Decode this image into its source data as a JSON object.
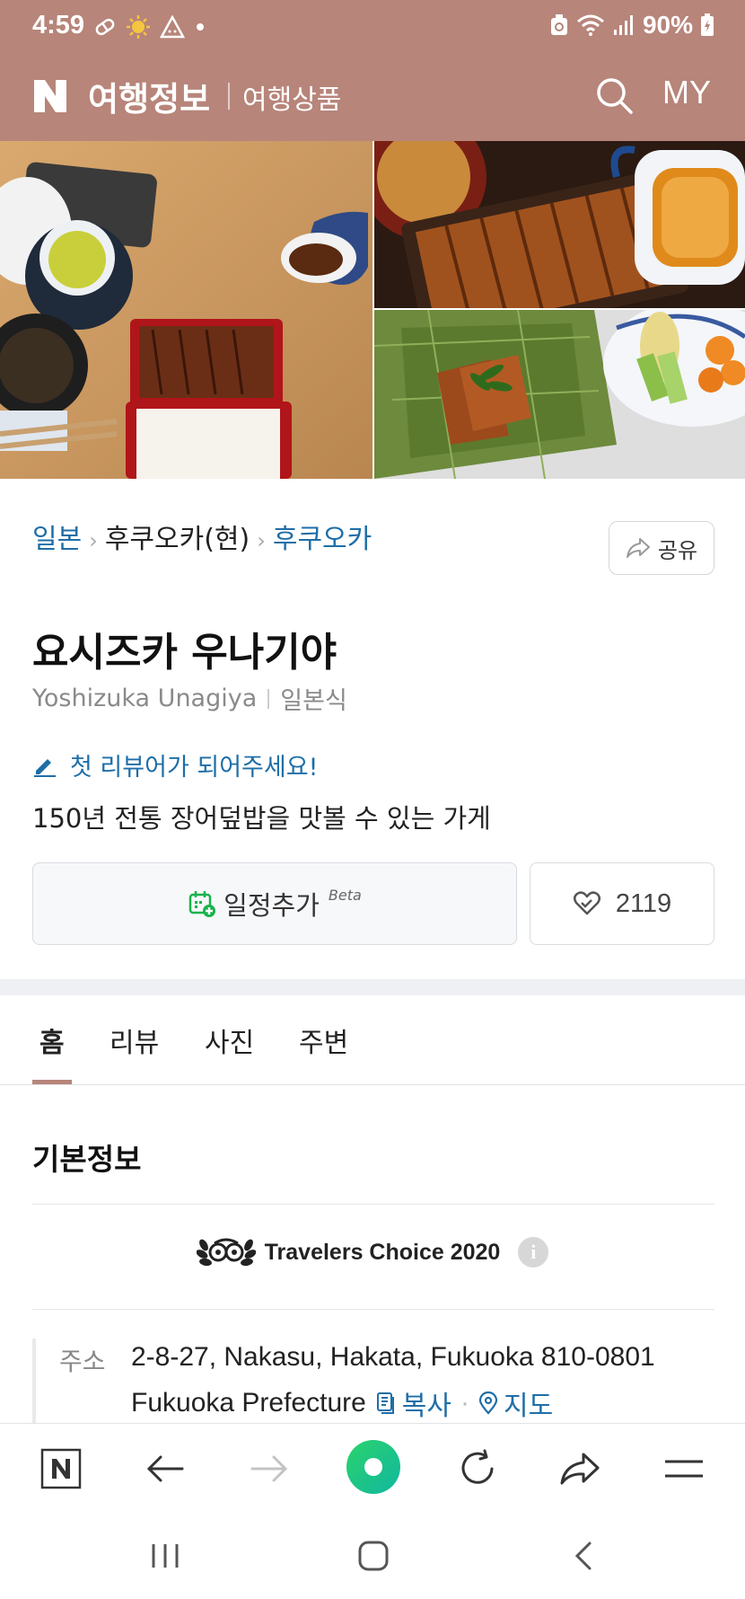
{
  "status_bar": {
    "time": "4:59",
    "battery": "90%",
    "icons": [
      "pill-icon",
      "sun-icon",
      "warning-icon",
      "dot-icon",
      "recycle-icon",
      "wifi-icon",
      "signal-icon",
      "battery-icon"
    ]
  },
  "header": {
    "logo": "N",
    "title": "여행정보",
    "subtitle_link": "여행상품",
    "my_label": "MY",
    "background": "#b7857a"
  },
  "breadcrumb": {
    "items": [
      "일본",
      "후쿠오카(현)",
      "후쿠오카"
    ]
  },
  "share_label": "공유",
  "place": {
    "name": "요시즈카 우나기야",
    "roman_name": "Yoshizuka Unagiya",
    "category": "일본식",
    "review_prompt": "첫 리뷰어가 되어주세요!",
    "description": "150년 전통 장어덮밥을 맛볼 수 있는 가게"
  },
  "actions": {
    "schedule_label": "일정추가",
    "schedule_badge": "Beta",
    "like_count": "2119"
  },
  "tabs": [
    "홈",
    "리뷰",
    "사진",
    "주변"
  ],
  "active_tab": "홈",
  "basic_info": {
    "title": "기본정보",
    "award": "Travelers Choice 2020",
    "address_label": "주소",
    "address_line1": "2-8-27, Nakasu, Hakata, Fukuoka 810-0801",
    "address_line2": "Fukuoka Prefecture",
    "copy_label": "복사",
    "map_label": "지도"
  },
  "colors": {
    "accent": "#b7857a",
    "link": "#1e6ea7",
    "green": "#19ce60"
  }
}
